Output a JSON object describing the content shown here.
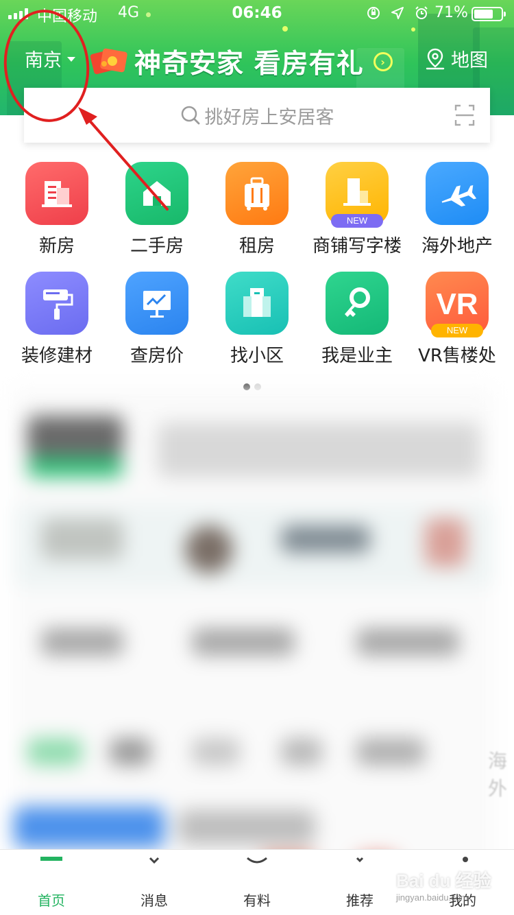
{
  "status_bar": {
    "carrier": "中国移动",
    "network": "4G",
    "time": "06:46",
    "battery": "71%",
    "battery_level": 0.71
  },
  "header": {
    "city": "南京",
    "promo_title": "神奇安家 看房有礼",
    "map_label": "地图"
  },
  "search": {
    "placeholder": "挑好房上安居客"
  },
  "categories": [
    {
      "label": "新房",
      "icon": "new-house-icon",
      "color": "#ef3f4a",
      "color2": "#ff6b6b"
    },
    {
      "label": "二手房",
      "icon": "second-hand-house-icon",
      "color": "#18b86a",
      "color2": "#2dd48a"
    },
    {
      "label": "租房",
      "icon": "rent-suitcase-icon",
      "color": "#ff7a12",
      "color2": "#ffa43a"
    },
    {
      "label": "商铺写字楼",
      "icon": "office-building-icon",
      "color": "#ffb400",
      "color2": "#ffd043",
      "badge": "NEW",
      "badge_color": "#7d6cf3"
    },
    {
      "label": "海外地产",
      "icon": "airplane-icon",
      "color": "#1e8cf5",
      "color2": "#4aa9ff"
    },
    {
      "label": "装修建材",
      "icon": "paint-roller-icon",
      "color": "#6b6cf0",
      "color2": "#8d8cff"
    },
    {
      "label": "查房价",
      "icon": "price-chart-icon",
      "color": "#2b84ef",
      "color2": "#4ea3ff"
    },
    {
      "label": "找小区",
      "icon": "community-buildings-icon",
      "color": "#18c0b4",
      "color2": "#3fdcc8"
    },
    {
      "label": "我是业主",
      "icon": "owner-key-icon",
      "color": "#14b877",
      "color2": "#2fd58f"
    },
    {
      "label": "VR售楼处",
      "icon": "vr-icon",
      "color": "#ff5a3c",
      "color2": "#ff8a4f",
      "badge": "NEW",
      "badge_color": "#ffb400",
      "glyph_text": "VR"
    }
  ],
  "feed_edge_text": "海外",
  "tabs": [
    {
      "label": "首页",
      "icon": "home-icon",
      "active": true
    },
    {
      "label": "消息",
      "icon": "message-icon",
      "active": false
    },
    {
      "label": "有料",
      "icon": "discover-icon",
      "active": false
    },
    {
      "label": "推荐",
      "icon": "recommend-icon",
      "active": false
    },
    {
      "label": "我的",
      "icon": "profile-icon",
      "active": false
    }
  ],
  "watermark": {
    "brand": "Bai du 经验",
    "url": "jingyan.baidu.com"
  },
  "colors": {
    "brand_green": "#23b360",
    "annotation_red": "#e02020"
  }
}
